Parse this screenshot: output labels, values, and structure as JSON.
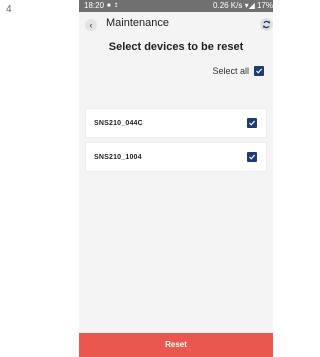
{
  "side_label": "4",
  "status_bar": {
    "time": "18:20",
    "right_text": "0.26 K/s ▾◢ 17%"
  },
  "header": {
    "back_symbol": "‹",
    "title": "Maintenance"
  },
  "page_heading": "Select devices to be reset",
  "select_all": {
    "label": "Select all",
    "checked": true
  },
  "devices": [
    {
      "name": "SNS210_044C",
      "checked": true
    },
    {
      "name": "SNS210_1004",
      "checked": true
    }
  ],
  "reset_label": "Reset",
  "colors": {
    "status_bar": "#707070",
    "accent_checkbox": "#1e3a7a",
    "reset_button": "#e9574f",
    "background": "#f4f4f4"
  },
  "icons": {
    "back": "back-arrow-icon",
    "sync": "sync-icon",
    "checkbox": "checkbox-checked-icon",
    "battery": "battery-icon",
    "wifi": "wifi-icon",
    "signal": "signal-icon"
  }
}
